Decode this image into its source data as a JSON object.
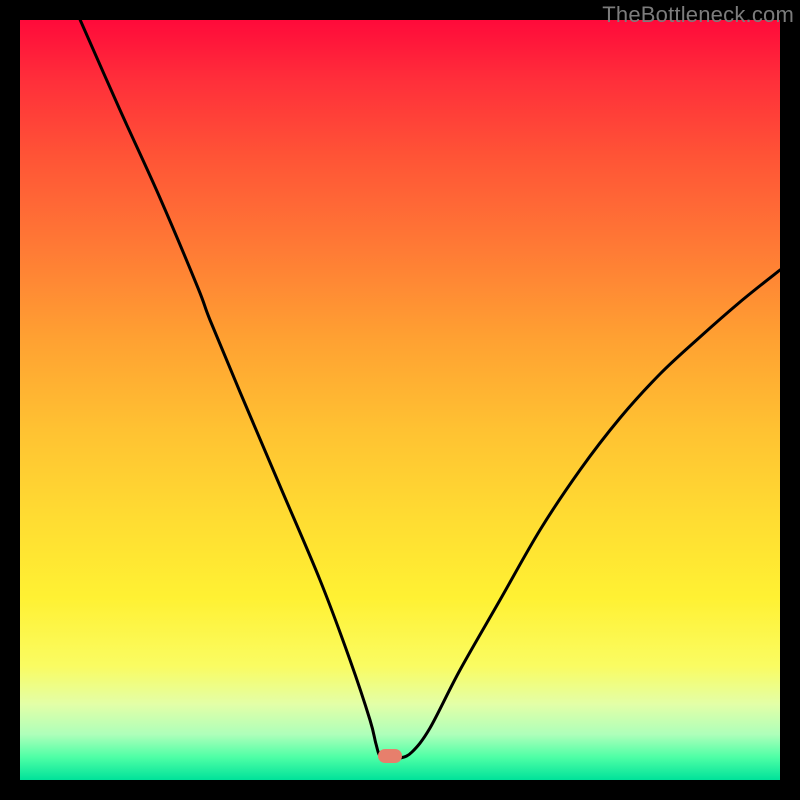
{
  "watermark": "TheBottleneck.com",
  "marker": {
    "cx": 370,
    "cy": 736,
    "w": 24,
    "h": 14,
    "color": "#e77f6c"
  },
  "curve": {
    "stroke": "#000000",
    "width": 3,
    "points": [
      [
        58,
        -5
      ],
      [
        100,
        90
      ],
      [
        140,
        178
      ],
      [
        178,
        268
      ],
      [
        190,
        300
      ],
      [
        220,
        372
      ],
      [
        260,
        466
      ],
      [
        300,
        560
      ],
      [
        330,
        640
      ],
      [
        350,
        700
      ],
      [
        356,
        724
      ],
      [
        360,
        736
      ],
      [
        368,
        738
      ],
      [
        380,
        738
      ],
      [
        392,
        732
      ],
      [
        410,
        708
      ],
      [
        440,
        650
      ],
      [
        480,
        580
      ],
      [
        520,
        510
      ],
      [
        560,
        450
      ],
      [
        600,
        398
      ],
      [
        640,
        354
      ],
      [
        680,
        317
      ],
      [
        720,
        282
      ],
      [
        760,
        250
      ]
    ]
  },
  "chart_data": {
    "type": "line",
    "title": "",
    "xlabel": "",
    "ylabel": "",
    "xlim": [
      0,
      100
    ],
    "ylim": [
      0,
      100
    ],
    "x": [
      7.6,
      13.2,
      18.4,
      23.4,
      25.0,
      28.9,
      34.2,
      39.5,
      43.4,
      46.1,
      46.8,
      47.4,
      48.4,
      50.0,
      51.6,
      53.9,
      57.9,
      63.2,
      68.4,
      73.7,
      78.9,
      84.2,
      89.5,
      94.7,
      100.0
    ],
    "values": [
      100.7,
      88.2,
      76.6,
      64.7,
      60.5,
      51.1,
      38.7,
      26.3,
      15.8,
      7.9,
      4.7,
      3.2,
      2.9,
      2.9,
      3.7,
      6.8,
      14.5,
      23.7,
      32.9,
      40.8,
      47.6,
      53.4,
      58.3,
      62.9,
      67.1
    ],
    "legend": [],
    "grid": false,
    "annotations": [
      {
        "type": "marker",
        "x": 48.7,
        "y": 3.2,
        "color": "#e77f6c"
      }
    ]
  }
}
